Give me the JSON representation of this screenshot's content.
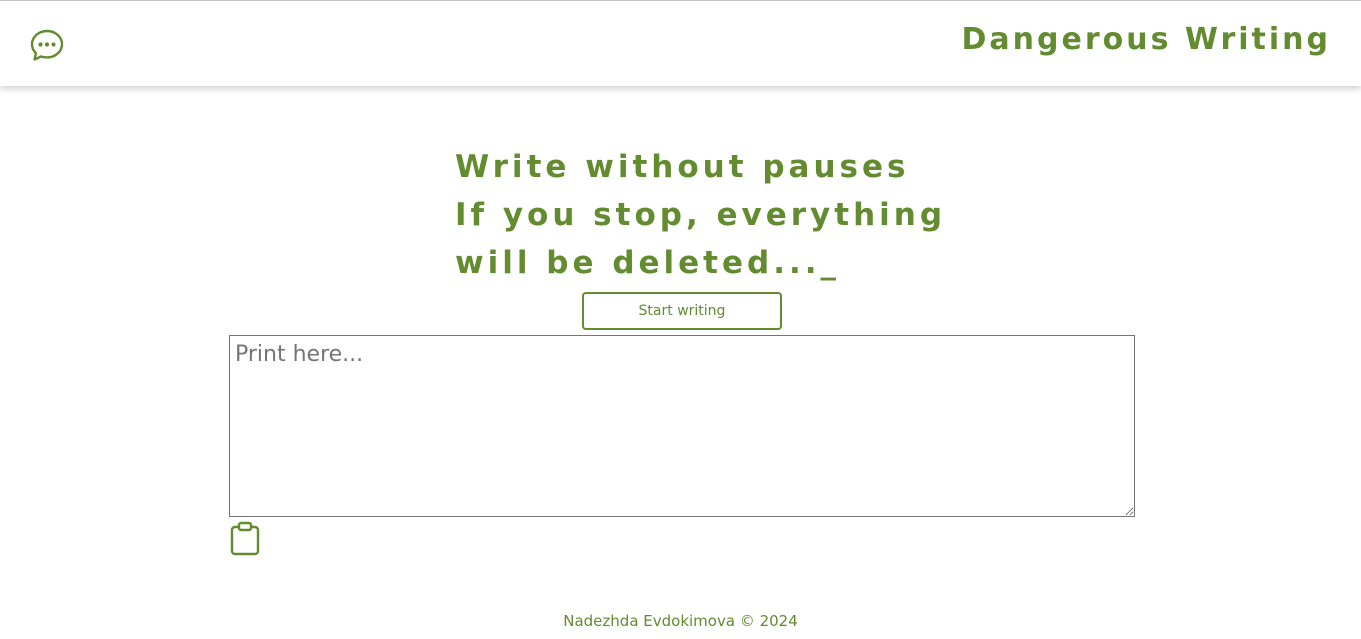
{
  "header": {
    "brand": "Dangerous Writing",
    "chat_icon": "chat-bubble-dots-icon"
  },
  "hero": {
    "lines": [
      "Write without pauses",
      "If you stop, everything",
      "will be deleted..._"
    ]
  },
  "start_button": {
    "label": "Start writing"
  },
  "editor": {
    "placeholder": "Print here...",
    "value": ""
  },
  "clipboard_icon": "clipboard-icon",
  "footer": {
    "text": "Nadezhda Evdokimova © 2024"
  },
  "colors": {
    "accent": "#638b2f",
    "background": "#ffffff",
    "border": "#767676"
  }
}
